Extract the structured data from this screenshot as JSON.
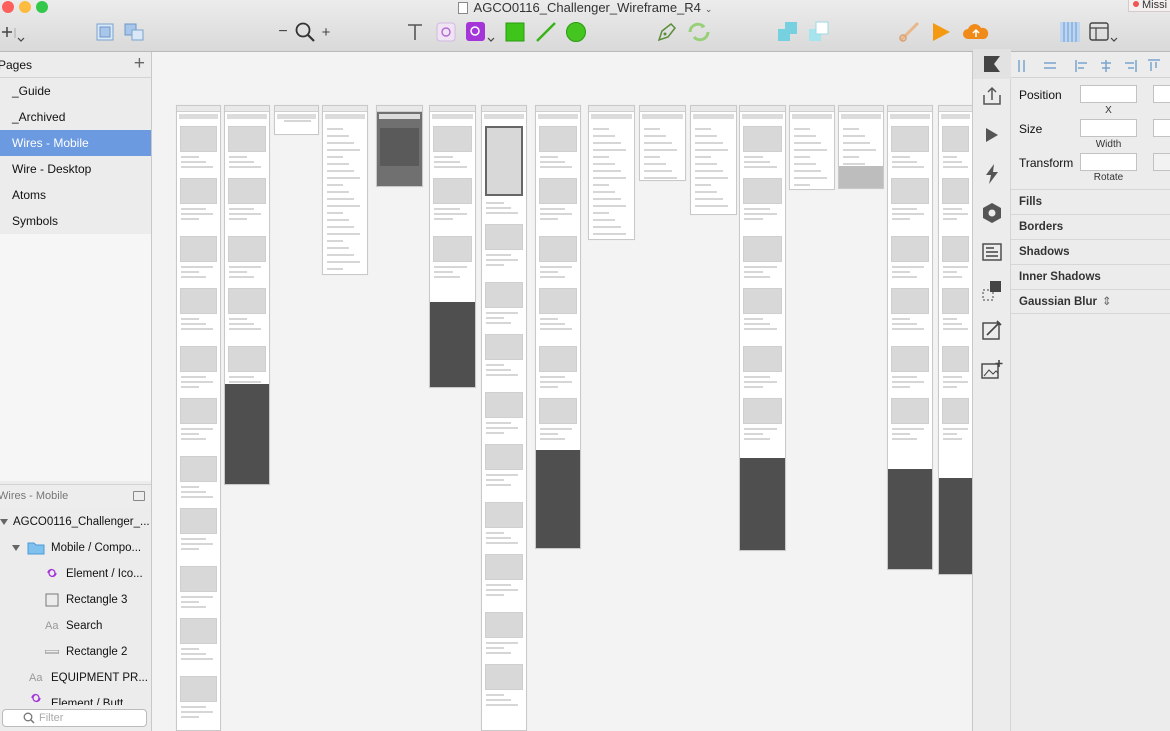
{
  "window": {
    "title": "AGCO0116_Challenger_Wireframe_R4",
    "missing_badge": "Missi",
    "traffic_colors": [
      "#fc605c",
      "#fdbc40",
      "#34c84a"
    ]
  },
  "toolbar": {
    "insert_icon": "plus-icon",
    "zoom_minus": "−",
    "zoom_plus": "+",
    "icons": [
      "group-icon",
      "ungroup-icon",
      "zoom-icon",
      "text-icon",
      "symbol-icon",
      "symbol-menu-icon",
      "rectangle-icon",
      "line-icon",
      "oval-icon",
      "pen-icon",
      "rotate-copies-icon",
      "union-icon",
      "subtract-icon",
      "scissors-icon",
      "preview-play-icon",
      "cloud-icon",
      "grid-icon",
      "view-icon"
    ]
  },
  "pages": {
    "header": "Pages",
    "items": [
      {
        "label": "_Guide",
        "selected": false
      },
      {
        "label": "_Archived",
        "selected": false
      },
      {
        "label": "Wires - Mobile",
        "selected": true
      },
      {
        "label": "Wire - Desktop",
        "selected": false
      },
      {
        "label": "Atoms",
        "selected": false
      },
      {
        "label": "Symbols",
        "selected": false
      }
    ]
  },
  "layers": {
    "header": "Wires - Mobile",
    "items": [
      {
        "label": "AGCO0116_Challenger_...",
        "icon": "artboard-icon"
      },
      {
        "label": "Mobile / Compo...",
        "icon": "folder-icon"
      },
      {
        "label": "Element / Ico...",
        "icon": "symbol-icon"
      },
      {
        "label": "Rectangle 3",
        "icon": "rectangle-icon"
      },
      {
        "label": "Search",
        "icon": "text-layer-icon"
      },
      {
        "label": "Rectangle 2",
        "icon": "line-layer-icon"
      },
      {
        "label": "EQUIPMENT PR...",
        "icon": "text-layer-icon"
      },
      {
        "label": "Element / Butt...",
        "icon": "symbol-icon"
      }
    ],
    "filter_placeholder": "Filter"
  },
  "inspector": {
    "position_label": "Position",
    "x_label": "X",
    "size_label": "Size",
    "width_label": "Width",
    "transform_label": "Transform",
    "rotate_label": "Rotate",
    "sections": [
      "Fills",
      "Borders",
      "Shadows",
      "Inner Shadows",
      "Gaussian Blur"
    ],
    "blur_stepper": "⇕"
  },
  "iconbar": {
    "icons": [
      "inspector-icon",
      "export-icon",
      "prototype-play-icon",
      "lightning-icon",
      "hexagon-icon",
      "layout-icon",
      "selection-icon",
      "edit-image-icon",
      "add-image-icon"
    ]
  }
}
